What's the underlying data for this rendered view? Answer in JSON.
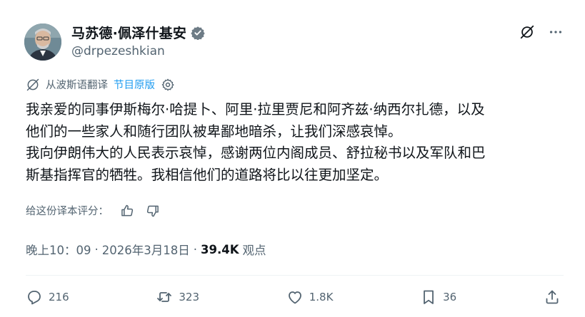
{
  "author": {
    "display_name": "马苏德·佩泽什基安",
    "handle": "@drpezeshkian",
    "verified_color": "#536471"
  },
  "translation": {
    "note": "从波斯语翻译",
    "show_original_label": "节目原版"
  },
  "tweet": {
    "text": "我亲爱的同事伊斯梅尔·哈提卜、阿里·拉里贾尼和阿齐兹·纳西尔扎德，以及\n他们的一些家人和随行团队被卑鄙地暗杀，让我们深感哀悼。\n我向伊朗伟大的人民表示哀悼，感谢两位内阁成员、舒拉秘书以及军队和巴\n斯基指挥官的牺牲。我相信他们的道路将比以往更加坚定。"
  },
  "rating": {
    "prompt": "给这份译本评分："
  },
  "meta": {
    "time": "晚上10：09",
    "date": "2026年3月18日",
    "separator": "·",
    "views_count": "39.4K",
    "views_label": "观点"
  },
  "actions": {
    "replies": "216",
    "reposts": "323",
    "likes": "1.8K",
    "bookmarks": "36"
  },
  "icons": {
    "avatar": "avatar-photo",
    "verified": "verified-badge-icon",
    "grok": "grok-icon",
    "more": "more-icon",
    "translate": "translate-icon",
    "settings": "settings-gear-icon",
    "thumbs_up": "thumbs-up-icon",
    "thumbs_down": "thumbs-down-icon",
    "reply": "reply-icon",
    "repost": "repost-icon",
    "like": "heart-icon",
    "bookmark": "bookmark-icon",
    "share": "share-icon"
  }
}
